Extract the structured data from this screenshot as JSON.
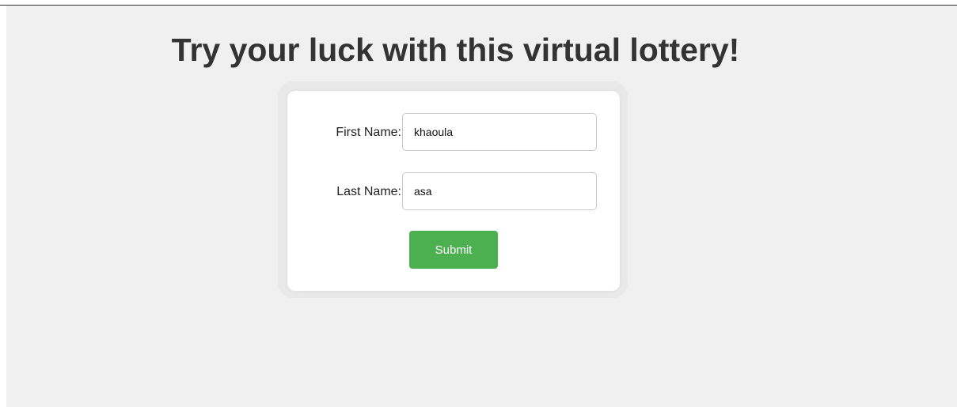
{
  "header": {
    "title": "Try your luck with this virtual lottery!"
  },
  "form": {
    "first_name_label": "First Name:",
    "first_name_value": "khaoula",
    "last_name_label": "Last Name:",
    "last_name_value": "asa",
    "submit_label": "Submit"
  },
  "colors": {
    "page_background": "#f0f0f0",
    "card_background": "#ffffff",
    "submit_button": "#4caf50",
    "title_text": "#333333"
  }
}
